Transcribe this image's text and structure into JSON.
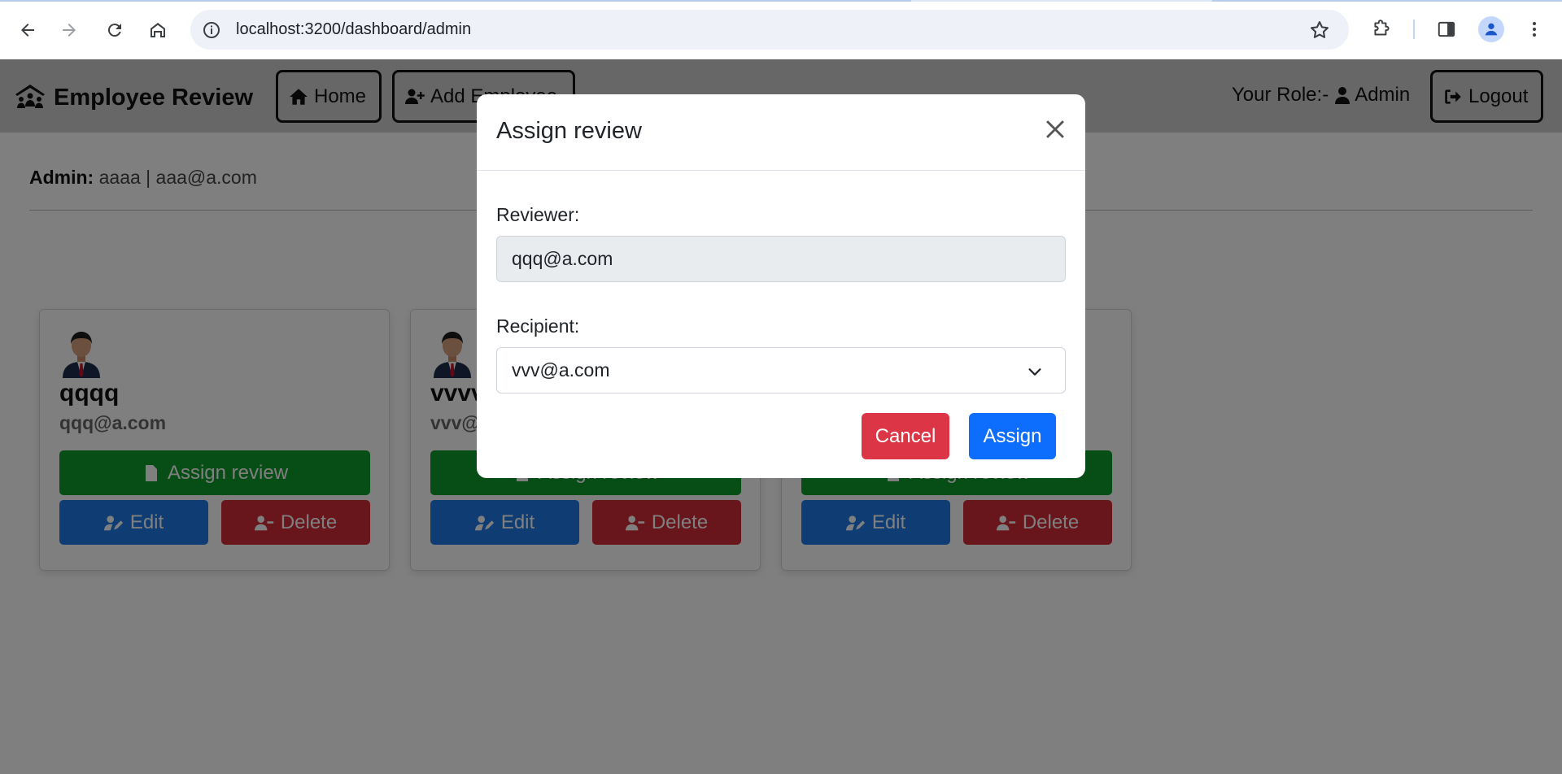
{
  "browser": {
    "url": "localhost:3200/dashboard/admin"
  },
  "navbar": {
    "brand": "Employee Review",
    "home_label": "Home",
    "add_label": "Add Employee",
    "role_prefix": "Your Role:-",
    "role_value": "Admin",
    "logout_label": "Logout"
  },
  "admin_info": {
    "label": "Admin:",
    "value": "aaaa | aaa@a.com"
  },
  "cards": [
    {
      "name": "qqqq",
      "email": "qqq@a.com",
      "assign_label": "Assign review",
      "edit_label": "Edit",
      "delete_label": "Delete"
    },
    {
      "name": "vvvv",
      "email": "vvv@a.com",
      "assign_label": "Assign review",
      "edit_label": "Edit",
      "delete_label": "Delete"
    },
    {
      "name": "",
      "email": "",
      "assign_label": "Assign review",
      "edit_label": "Edit",
      "delete_label": "Delete"
    }
  ],
  "modal": {
    "title": "Assign review",
    "reviewer_label": "Reviewer:",
    "reviewer_value": "qqq@a.com",
    "recipient_label": "Recipient:",
    "recipient_value": "vvv@a.com",
    "cancel_label": "Cancel",
    "assign_label": "Assign"
  },
  "colors": {
    "navbar_bg": "#cfcfcf",
    "assign_green": "#0f9d2d",
    "edit_blue": "#1f7be6",
    "delete_red": "#d32a38",
    "modal_cancel": "#dc3545",
    "modal_assign": "#0d6efd"
  }
}
